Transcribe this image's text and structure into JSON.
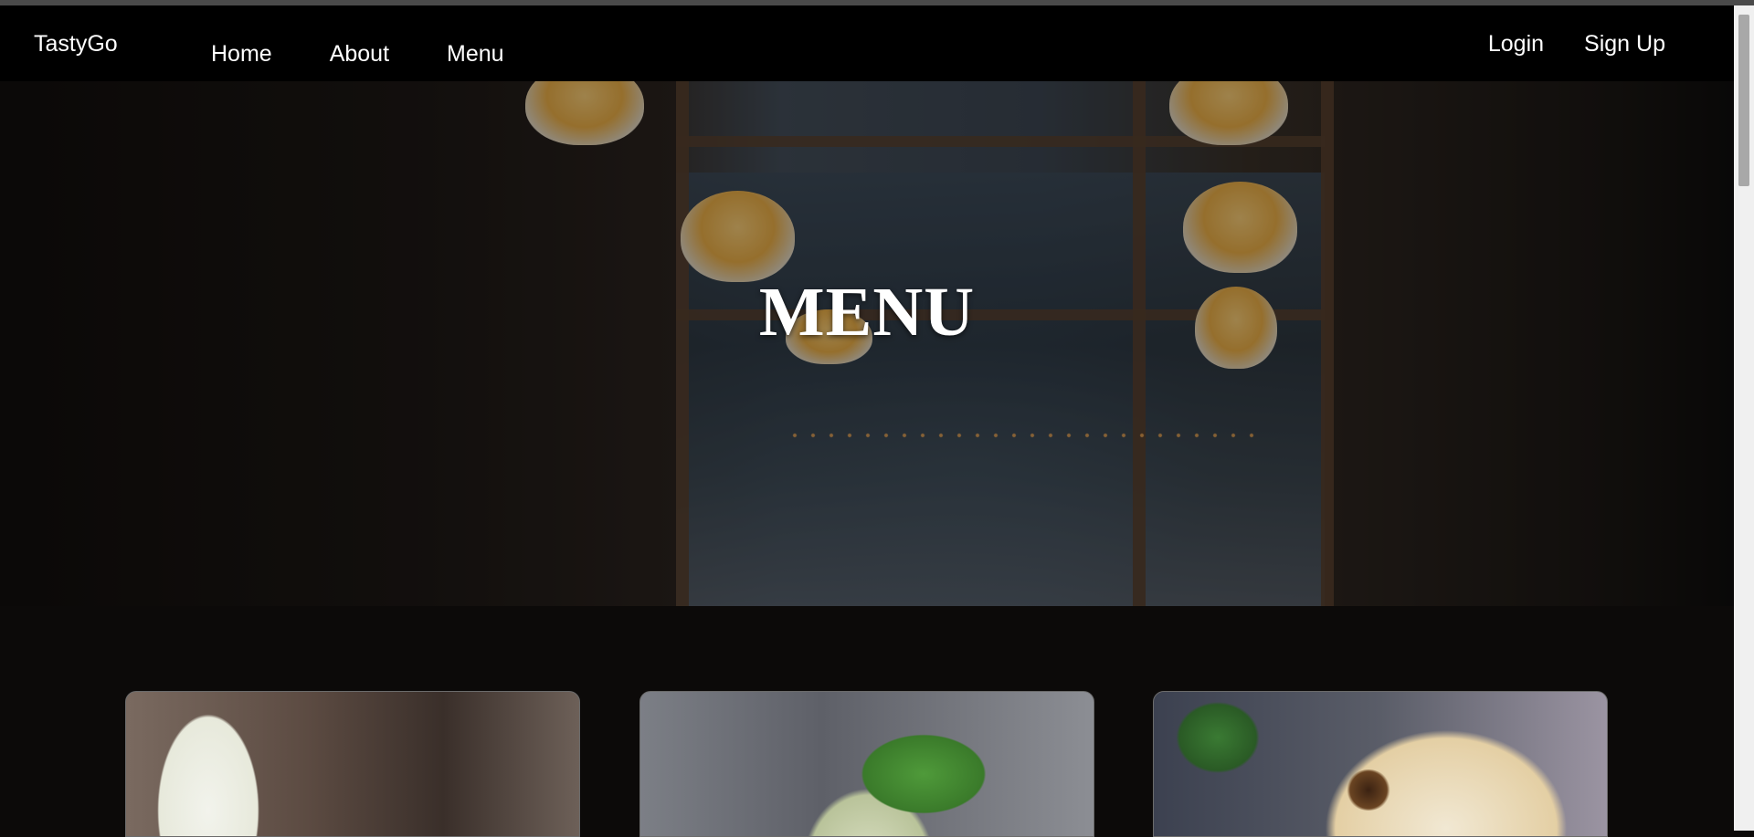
{
  "nav": {
    "brand": "TastyGo",
    "links": [
      "Home",
      "About",
      "Menu"
    ],
    "auth": [
      "Login",
      "Sign Up"
    ]
  },
  "hero": {
    "title": "MENU"
  },
  "colors": {
    "navbar_bg": "#000000",
    "page_bg": "#0c0a09",
    "text": "#ffffff"
  }
}
